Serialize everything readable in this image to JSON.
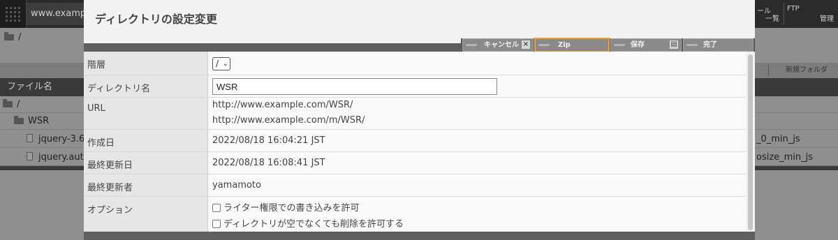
{
  "background": {
    "site": "www.exampl",
    "menu_right": [
      {
        "top": "ール",
        "bottom": "一覧"
      },
      {
        "top": "FTP",
        "bottom": "管理"
      }
    ],
    "path": "/",
    "new_folder_label": "新規フォルダ",
    "column_header": "ファイル名",
    "rows": [
      {
        "name": "/",
        "type": "folder",
        "right": ""
      },
      {
        "name": "WSR",
        "type": "folder",
        "right": ""
      },
      {
        "name": "jquery-3.6",
        "type": "file",
        "right": "_0_min_js"
      },
      {
        "name": "jquery.aut",
        "type": "file",
        "right": "osize_min_js"
      }
    ]
  },
  "modal": {
    "title": "ディレクトリの設定変更",
    "buttons": {
      "cancel": "キャンセル",
      "cancel_icon": "×",
      "zip": "Zip",
      "save": "保存",
      "done": "完了"
    },
    "fields": {
      "level_label": "階層",
      "level_value": "/",
      "dirname_label": "ディレクトリ名",
      "dirname_value": "WSR",
      "url_label": "URL",
      "url_1": "http://www.example.com/WSR/",
      "url_2": "http://www.example.com/m/WSR/",
      "created_label": "作成日",
      "created_value": "2022/08/18 16:04:21 JST",
      "updated_label": "最終更新日",
      "updated_value": "2022/08/18 16:08:41 JST",
      "updater_label": "最終更新者",
      "updater_value": "yamamoto",
      "option_label": "オプション",
      "option_1": "ライター権限での書き込みを許可",
      "option_2": "ディレクトリが空でなくても削除を許可する"
    }
  }
}
